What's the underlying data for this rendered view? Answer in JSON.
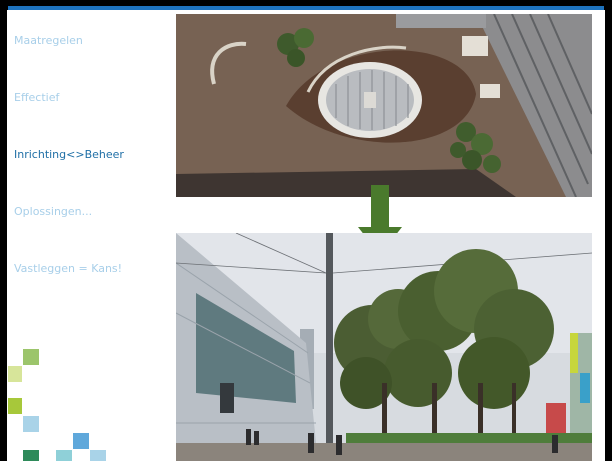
{
  "nav": {
    "items": [
      {
        "label": "Maatregelen",
        "active": false
      },
      {
        "label": "Effectief",
        "active": false
      },
      {
        "label": "Inrichting<>Beheer",
        "active": true
      },
      {
        "label": "Oplossingen...",
        "active": false
      },
      {
        "label": "Vastleggen = Kans!",
        "active": false
      }
    ]
  },
  "colors": {
    "accent": "#1e73be",
    "nav_inactive": "#a8cfe9",
    "nav_active": "#1f6fa6",
    "arrow": "#4a7a2c"
  },
  "images": {
    "top": "aerial-view-square-icon",
    "bottom": "street-trees-photo-icon"
  }
}
